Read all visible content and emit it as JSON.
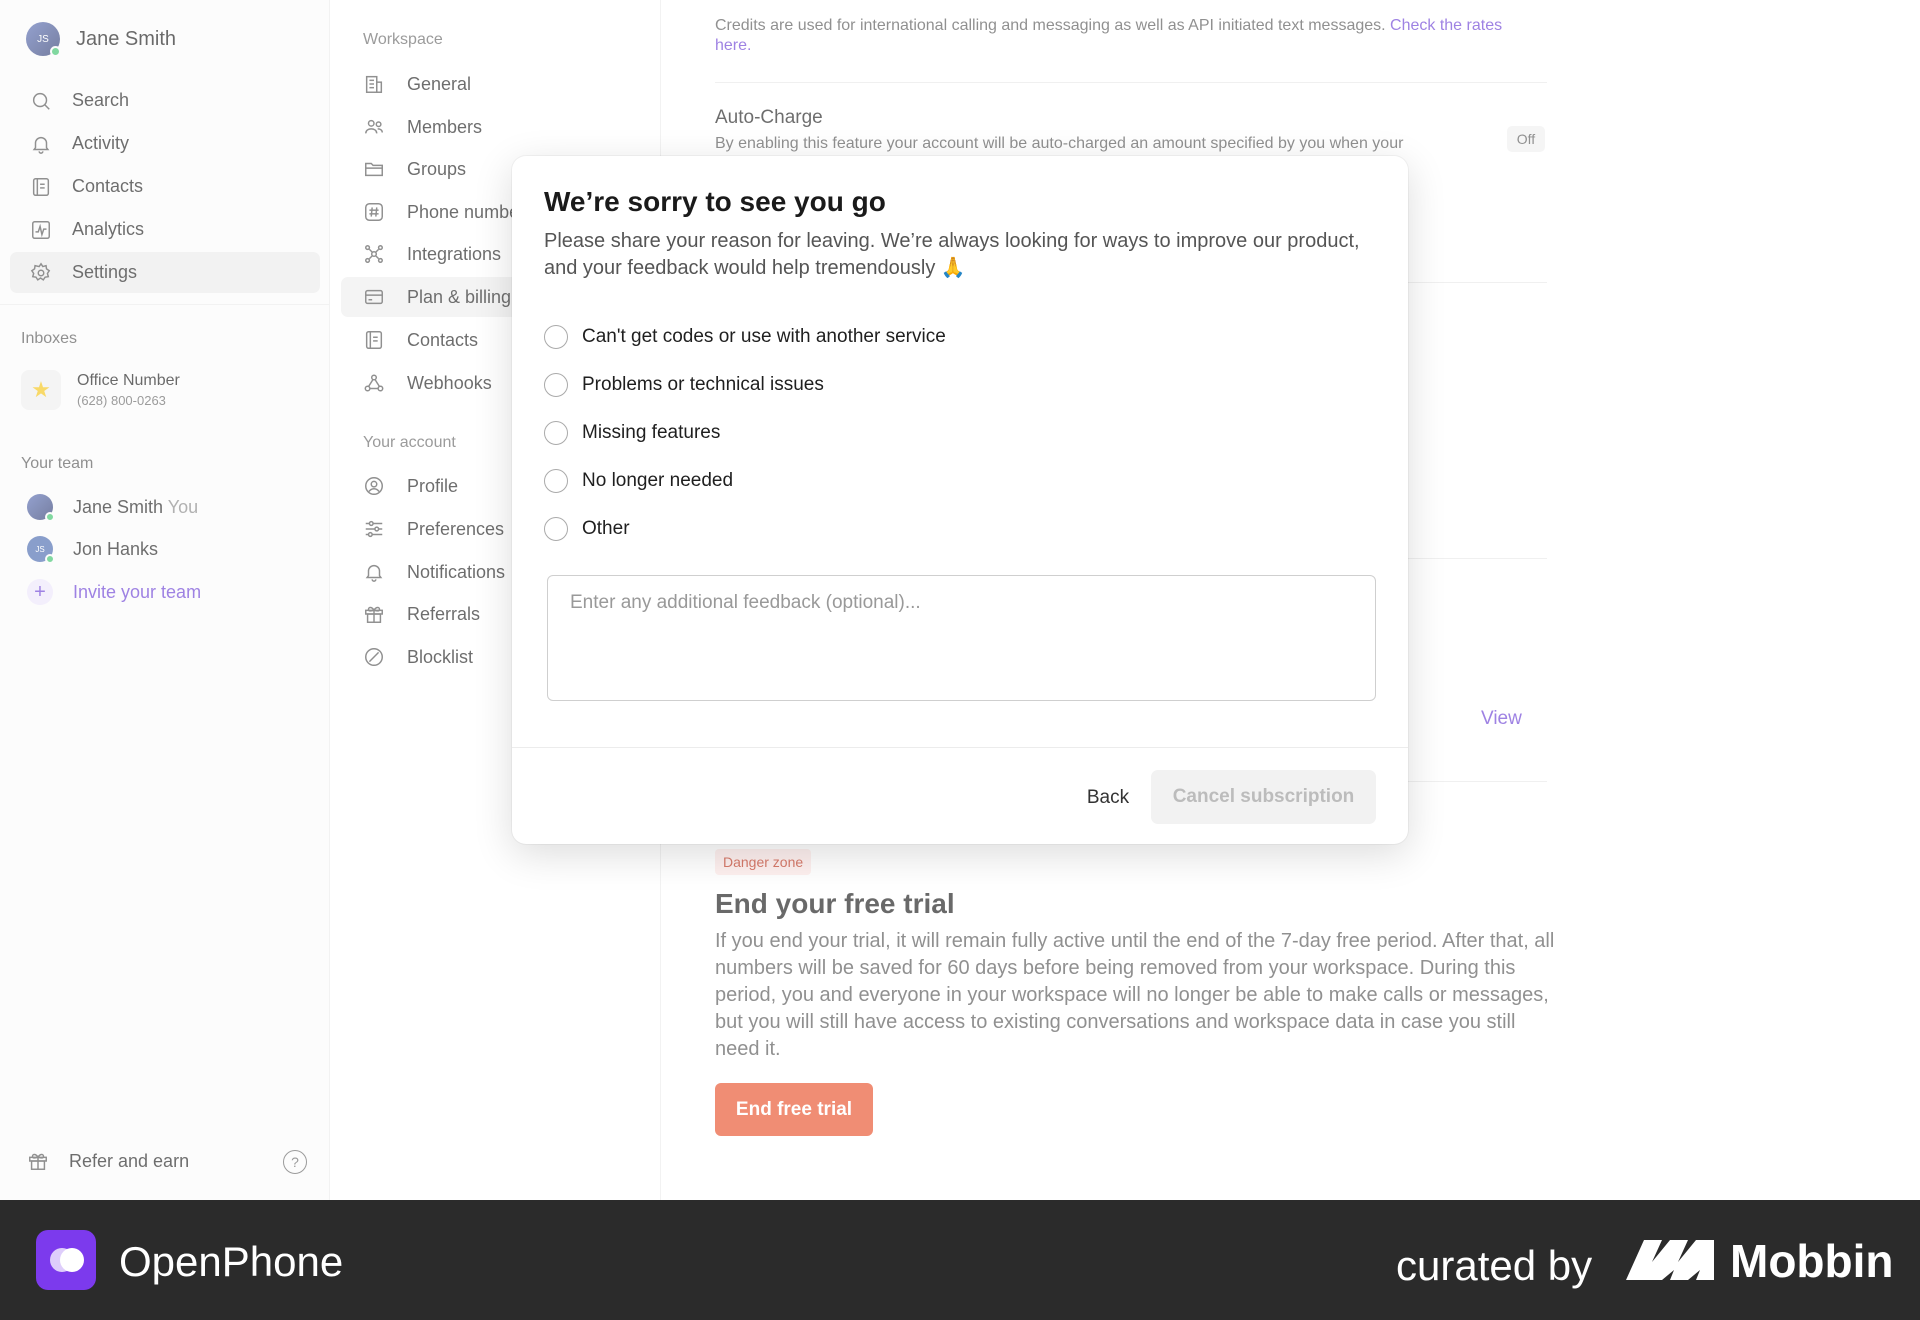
{
  "user": {
    "name": "Jane Smith",
    "initials": "JS"
  },
  "nav": {
    "items": [
      {
        "label": "Search",
        "icon": "search-icon"
      },
      {
        "label": "Activity",
        "icon": "bell-icon"
      },
      {
        "label": "Contacts",
        "icon": "contacts-icon"
      },
      {
        "label": "Analytics",
        "icon": "analytics-icon"
      },
      {
        "label": "Settings",
        "icon": "gear-icon"
      }
    ],
    "active": "Settings"
  },
  "inboxes": {
    "label": "Inboxes",
    "items": [
      {
        "name": "Office Number",
        "number": "(628) 800-0263",
        "icon": "star-icon"
      }
    ]
  },
  "team": {
    "label": "Your team",
    "members": [
      {
        "name": "Jane Smith",
        "tag": "You"
      },
      {
        "name": "Jon Hanks",
        "tag": ""
      }
    ],
    "invite_label": "Invite your team"
  },
  "footer_nav": {
    "refer_label": "Refer and earn"
  },
  "settings_nav": {
    "workspace_label": "Workspace",
    "workspace_items": [
      {
        "label": "General",
        "icon": "building-icon"
      },
      {
        "label": "Members",
        "icon": "members-icon"
      },
      {
        "label": "Groups",
        "icon": "folder-icon"
      },
      {
        "label": "Phone numbers",
        "icon": "hash-icon"
      },
      {
        "label": "Integrations",
        "icon": "integrations-icon"
      },
      {
        "label": "Plan & billing",
        "icon": "card-icon"
      },
      {
        "label": "Contacts",
        "icon": "contacts-icon"
      },
      {
        "label": "Webhooks",
        "icon": "webhooks-icon"
      }
    ],
    "account_label": "Your account",
    "account_items": [
      {
        "label": "Profile",
        "icon": "profile-icon"
      },
      {
        "label": "Preferences",
        "icon": "sliders-icon"
      },
      {
        "label": "Notifications",
        "icon": "bell-icon"
      },
      {
        "label": "Referrals",
        "icon": "gift-icon"
      },
      {
        "label": "Blocklist",
        "icon": "block-icon"
      }
    ],
    "active": "Plan & billing"
  },
  "main": {
    "credits_desc": "Credits are used for international calling and messaging as well as API initiated text messages.",
    "credits_link": "Check the rates here.",
    "auto_charge_title": "Auto-Charge",
    "auto_charge_desc": "By enabling this feature your account will be auto-charged an amount specified by you when your",
    "auto_charge_status": "Off",
    "view_link": "View",
    "danger_badge": "Danger zone",
    "trial_title": "End your free trial",
    "trial_desc": "If you end your trial, it will remain fully active until the end of the 7-day free period. After that, all numbers will be saved for 60 days before being removed from your workspace. During this period, you and everyone in your workspace will no longer be able to make calls or messages, but you will still have access to existing conversations and workspace data in case you still need it.",
    "end_trial_button": "End free trial"
  },
  "modal": {
    "title": "We’re sorry to see you go",
    "subtitle": "Please share your reason for leaving. We’re always looking for ways to improve our product, and your feedback would help tremendously 🙏",
    "options": [
      "Can't get codes or use with another service",
      "Problems or technical issues",
      "Missing features",
      "No longer needed",
      "Other"
    ],
    "feedback_placeholder": "Enter any additional feedback (optional)...",
    "feedback_value": "",
    "back_button": "Back",
    "cancel_button": "Cancel subscription"
  },
  "branding": {
    "app_name": "OpenPhone",
    "curated_by": "curated by",
    "curator": "Mobbin"
  },
  "colors": {
    "accent": "#6b3fd4",
    "danger": "#e8512a",
    "footer_bg": "#2b2b2b",
    "openphone_brand": "#7c3aed"
  }
}
